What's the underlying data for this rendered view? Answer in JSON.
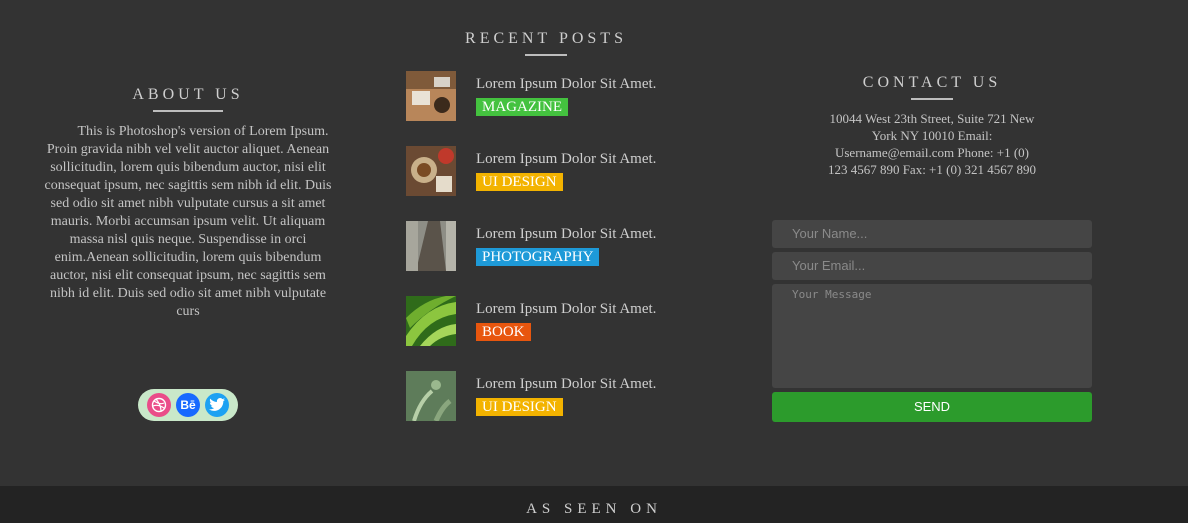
{
  "about": {
    "title": "ABOUT US",
    "text": "This is Photoshop's version of Lorem Ipsum. Proin gravida nibh vel velit auctor aliquet. Aenean sollicitudin, lorem quis bibendum auctor, nisi elit consequat ipsum, nec sagittis sem nibh id elit. Duis sed odio sit amet nibh vulputate cursus a sit amet mauris. Morbi accumsan ipsum velit. Ut aliquam massa nisl quis neque. Suspendisse in orci enim.Aenean sollicitudin, lorem quis bibendum auctor, nisi elit consequat ipsum, nec sagittis sem nibh id elit. Duis sed odio sit amet nibh vulputate curs",
    "social_icons": [
      "dribbble-icon",
      "behance-icon",
      "twitter-icon"
    ],
    "behance_glyph": "Bē"
  },
  "recent": {
    "title": "RECENT POSTS",
    "posts": [
      {
        "title": "Lorem Ipsum Dolor Sit Amet.",
        "tag": "MAGAZINE",
        "tag_color": "#44c23f"
      },
      {
        "title": "Lorem Ipsum Dolor Sit Amet.",
        "tag": "UI DESIGN",
        "tag_color": "#f3b300"
      },
      {
        "title": "Lorem Ipsum Dolor Sit Amet.",
        "tag": "PHOTOGRAPHY",
        "tag_color": "#1e9ad8"
      },
      {
        "title": "Lorem Ipsum Dolor Sit Amet.",
        "tag": "BOOK",
        "tag_color": "#e8560e"
      },
      {
        "title": "Lorem Ipsum Dolor Sit Amet.",
        "tag": "UI DESIGN",
        "tag_color": "#f3b300"
      }
    ]
  },
  "contact": {
    "title": "CONTACT US",
    "text": "10044 West 23th Street, Suite 721 New York NY 10010 Email: Username@email.com Phone: +1 (0) 123 4567 890 Fax: +1 (0) 321 4567 890",
    "name_placeholder": "Your Name...",
    "email_placeholder": "Your Email...",
    "message_placeholder": "Your Message",
    "send_label": "SEND",
    "send_color": "#2c9b2c"
  },
  "footer": {
    "title": "AS SEEN ON"
  }
}
